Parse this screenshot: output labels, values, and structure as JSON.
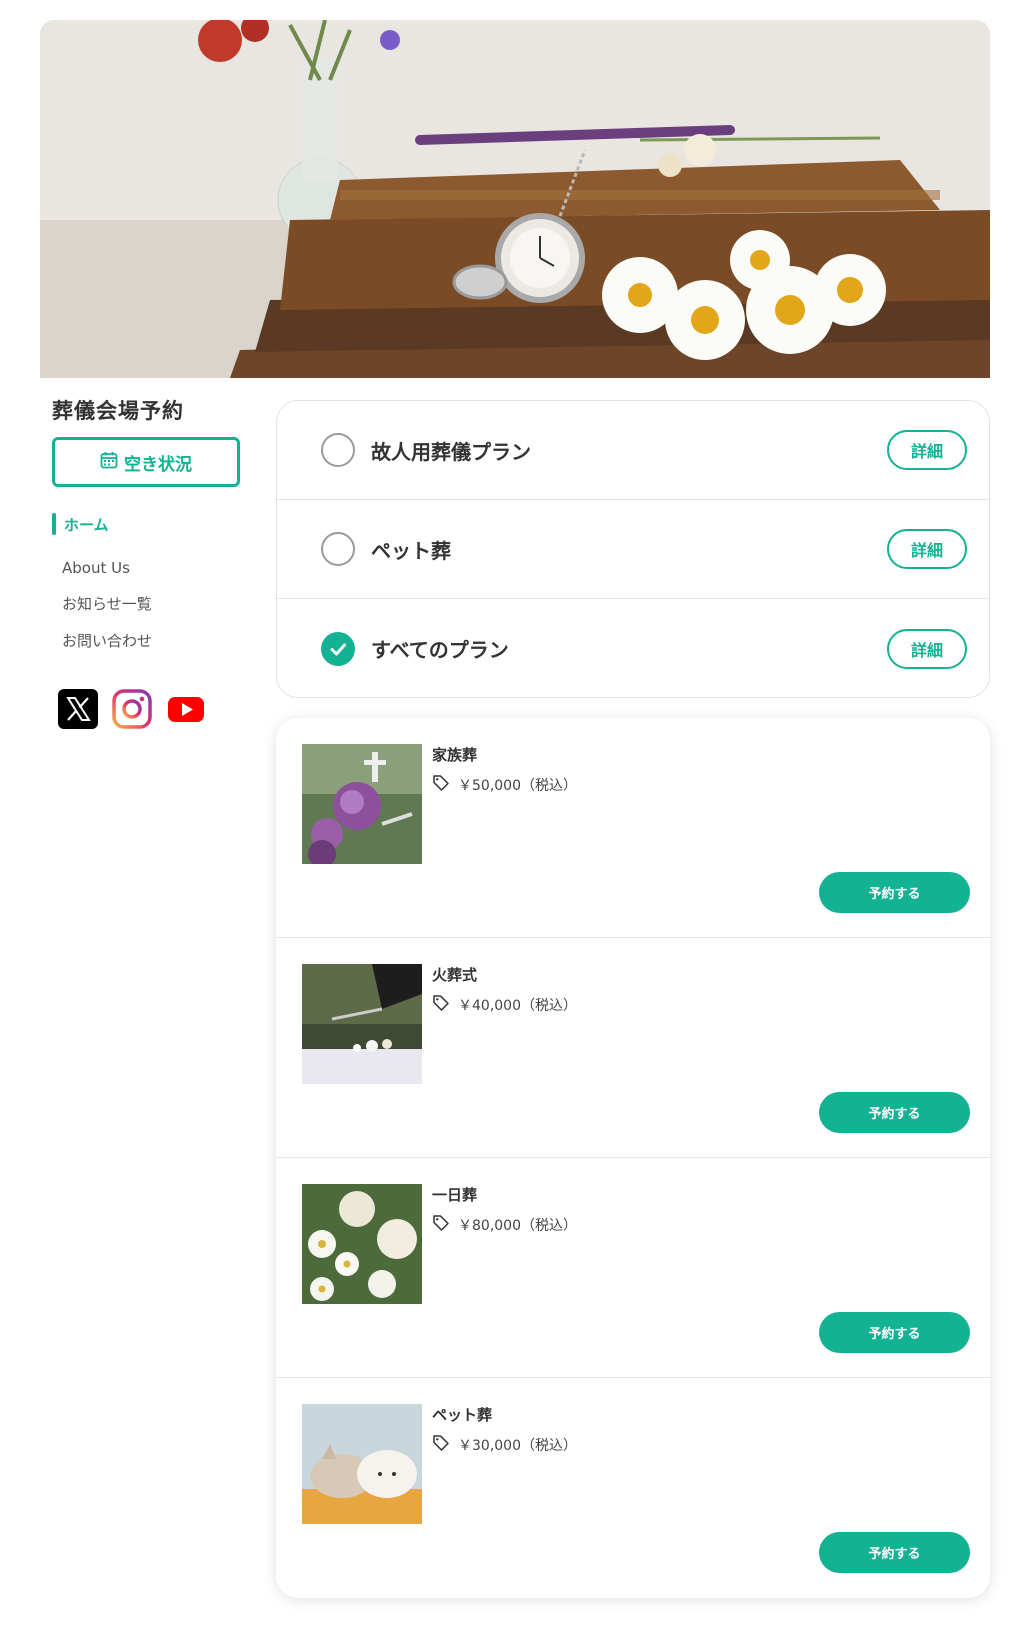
{
  "site": {
    "title": "葬儀会場予約"
  },
  "sidebar": {
    "availability_label": "空き状況",
    "nav_home": "ホーム",
    "nav_items": [
      "About Us",
      "お知らせ一覧",
      "お問い合わせ"
    ]
  },
  "social": [
    "x-icon",
    "instagram-icon",
    "youtube-icon"
  ],
  "plans": [
    {
      "label": "故人用葬儀プラン",
      "selected": false,
      "detail_label": "詳細"
    },
    {
      "label": "ペット葬",
      "selected": false,
      "detail_label": "詳細"
    },
    {
      "label": "すべてのプラン",
      "selected": true,
      "detail_label": "詳細"
    }
  ],
  "products": [
    {
      "name": "家族葬",
      "price": "￥50,000（税込）",
      "button": "予約する"
    },
    {
      "name": "火葬式",
      "price": "￥40,000（税込）",
      "button": "予約する"
    },
    {
      "name": "一日葬",
      "price": "￥80,000（税込）",
      "button": "予約する"
    },
    {
      "name": "ペット葬",
      "price": "￥30,000（税込）",
      "button": "予約する"
    }
  ],
  "colors": {
    "accent": "#12b292"
  }
}
